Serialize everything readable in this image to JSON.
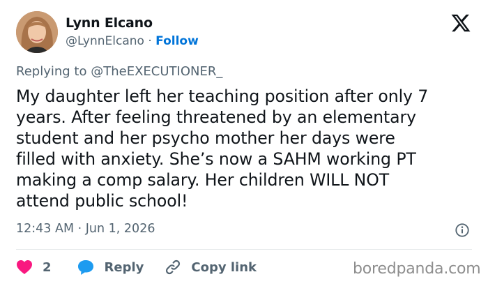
{
  "author": {
    "name": "Lynn Elcano",
    "handle": "@LynnElcano",
    "separator": "·",
    "follow_label": "Follow",
    "avatar_icon": "user-avatar"
  },
  "platform_icon": "x-logo-icon",
  "reply_context": {
    "prefix": "Replying to",
    "mention": "@TheEXECUTIONER_"
  },
  "tweet": {
    "text": "My daughter left her teaching position after only 7\nyears. After feeling threatened by an elementary\nstudent and her psycho mother her days were\nfilled with anxiety. She’s now a SAHM working PT\nmaking a comp salary. Her children WILL NOT\nattend public school!",
    "timestamp": "12:43 AM · Jun 1, 2026"
  },
  "actions": {
    "like_count": "2",
    "reply_label": "Reply",
    "copy_link_label": "Copy link"
  },
  "watermark": "boredpanda.com",
  "colors": {
    "link": "#0074d9",
    "like": "#f91880",
    "reply": "#1d9bf0",
    "muted": "#536471",
    "text": "#0f1419"
  }
}
